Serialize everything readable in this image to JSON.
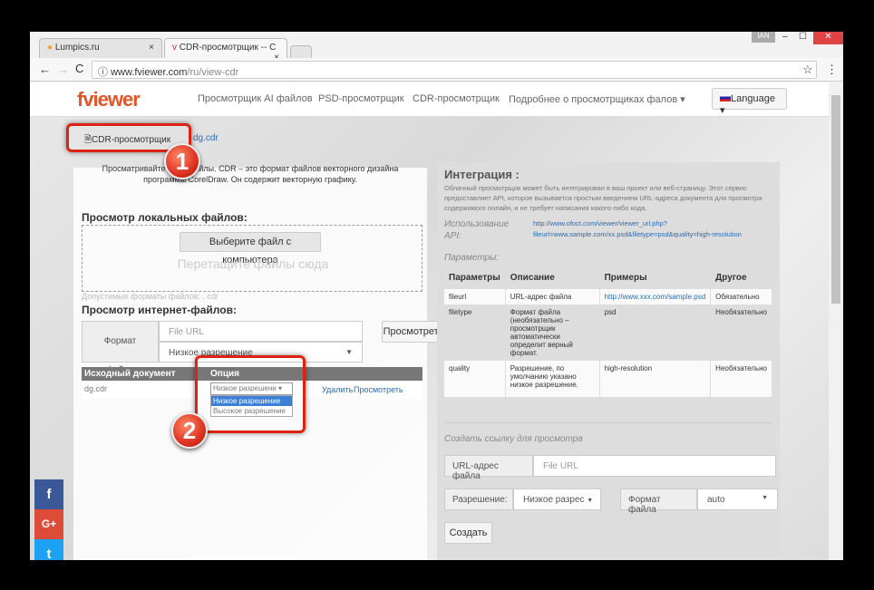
{
  "browser": {
    "tabs": [
      {
        "label": "Lumpics.ru"
      },
      {
        "label": "CDR-просмотрщик -- С"
      }
    ],
    "url_host": "www.fviewer.com",
    "url_path": "/ru/view-cdr",
    "user_badge": "IAN",
    "minimize": "–",
    "maximize": "☐",
    "close": "✕"
  },
  "header": {
    "logo": "fviewer",
    "nav": [
      "Просмотрщик AI файлов",
      "PSD-просмотрщик",
      "CDR-просмотрщик",
      "Подробнее о просмотрщиках фалов ▾"
    ],
    "language": "Language ▾"
  },
  "breadcrumb": {
    "current": "CDR-просмотрщик",
    "file": "dg.cdr"
  },
  "intro": {
    "line1": "Просматривайте CDR файлы. CDR – это формат файлов векторного дизайна",
    "line2": "программы CorelDraw. Он содержит векторную графику."
  },
  "local": {
    "title": "Просмотр локальных файлов:",
    "choose_button": "Выберите файл с компьютера",
    "drop_text": "Перетащите файлы сюда",
    "formats": "Допустимые форматы файлов: . cdr"
  },
  "online": {
    "title": "Просмотр интернет-файлов:",
    "format_label": "Формат файла",
    "url_placeholder": "File URL",
    "quality_value": "Низкое разрешение",
    "view_button": "Просмотреть"
  },
  "files_table": {
    "headers": [
      "Исходный документ",
      "Опция"
    ],
    "rows": [
      {
        "name": "dg.cdr",
        "option": "Низкое разрешени",
        "delete": "Удалить",
        "view": "Просмотреть"
      }
    ],
    "dropdown_options": [
      "Низкое разрешение",
      "Высокое разрешение"
    ]
  },
  "annotations": [
    "1",
    "2"
  ],
  "integration": {
    "title": "Интеграция :",
    "description": "Облачный просмотрщик может быть интегрирован в ваш проект или веб-страницу. Этот сервис предоставляет API, которое вызывается простым введением URL-адреса документа для просмотра содержимого онлайн, и не требует написания какого-либо кода.",
    "api_label": "Использование API:",
    "api_url1": "http://www.ofoct.com/viewer/viewer_url.php?",
    "api_url2": "fileurl=www.sample.com/xx.psd&filetype=psd&quality=high-resolution",
    "params_label": "Параметры:",
    "table_headers": [
      "Параметры",
      "Описание",
      "Примеры",
      "Другое"
    ],
    "rows": [
      [
        "fileurl",
        "URL-адрес файла",
        "http://www.xxx.com/sample.psd",
        "Обязательно"
      ],
      [
        "filetype",
        "Формат файла (необязательно – просмотрщик автоматически определит верный формат.",
        "psd",
        "Необязательно"
      ],
      [
        "quality",
        "Разрешение, по умолчанию указано низкое разрешение.",
        "high-resolution",
        "Необязательно"
      ]
    ],
    "create_link_label": "Создать ссылку для просмотра",
    "url_label": "URL-адрес файла",
    "url_placeholder": "File URL",
    "resolution_label": "Разрешение:",
    "resolution_value": "Низкое разрес",
    "format_label": "Формат файла",
    "format_value": "auto",
    "create_button": "Создать"
  },
  "social": {
    "facebook": "f",
    "google": "G+",
    "twitter": "t"
  }
}
